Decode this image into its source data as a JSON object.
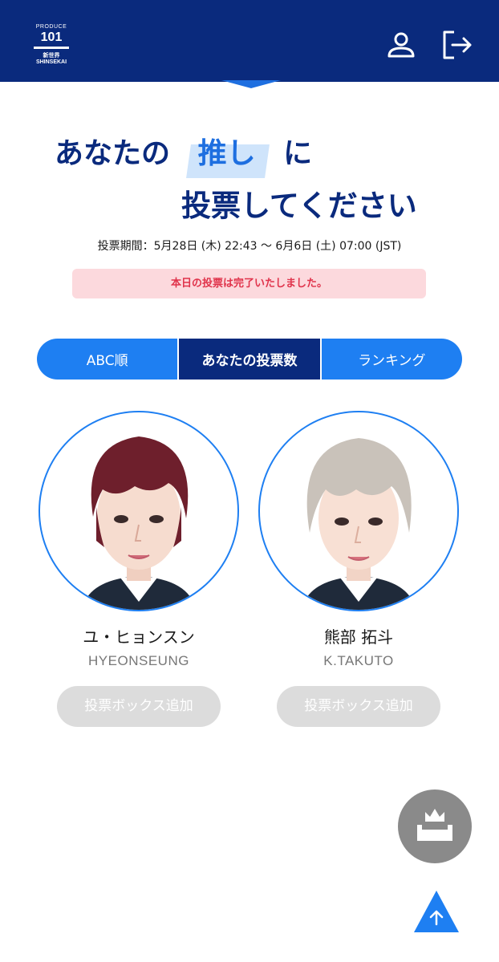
{
  "header": {
    "logo": {
      "top": "PRODUCE",
      "main": "101",
      "sub": "新世界SHINSEKAI"
    },
    "icons": {
      "account": "user-icon",
      "logout": "logout-icon"
    }
  },
  "headline": {
    "line1_a": "あなたの",
    "line1_highlight": "推し",
    "line1_b": "に",
    "line2": "投票してください"
  },
  "period": "投票期間：5月28日 (木) 22:43 〜 6月6日 (土) 07:00 (JST)",
  "notice": "本日の投票は完了いたしました。",
  "tabs": [
    {
      "label": "ABC順",
      "active": false
    },
    {
      "label": "あなたの投票数",
      "active": true
    },
    {
      "label": "ランキング",
      "active": false
    }
  ],
  "candidates": [
    {
      "name": "ユ・ヒョンスン",
      "romaji": "HYEONSEUNG",
      "button": "投票ボックス追加",
      "hair_color": "#6e1f2c"
    },
    {
      "name": "熊部 拓斗",
      "romaji": "K.TAKUTO",
      "button": "投票ボックス追加",
      "hair_color": "#c9c2ba"
    }
  ],
  "fab_icon": "crown-box-icon",
  "scroll_top_icon": "arrow-up-icon",
  "colors": {
    "navy": "#0a2a7d",
    "blue": "#1e7ff2",
    "notice_bg": "#fcd9dd",
    "notice_text": "#e0334b"
  }
}
